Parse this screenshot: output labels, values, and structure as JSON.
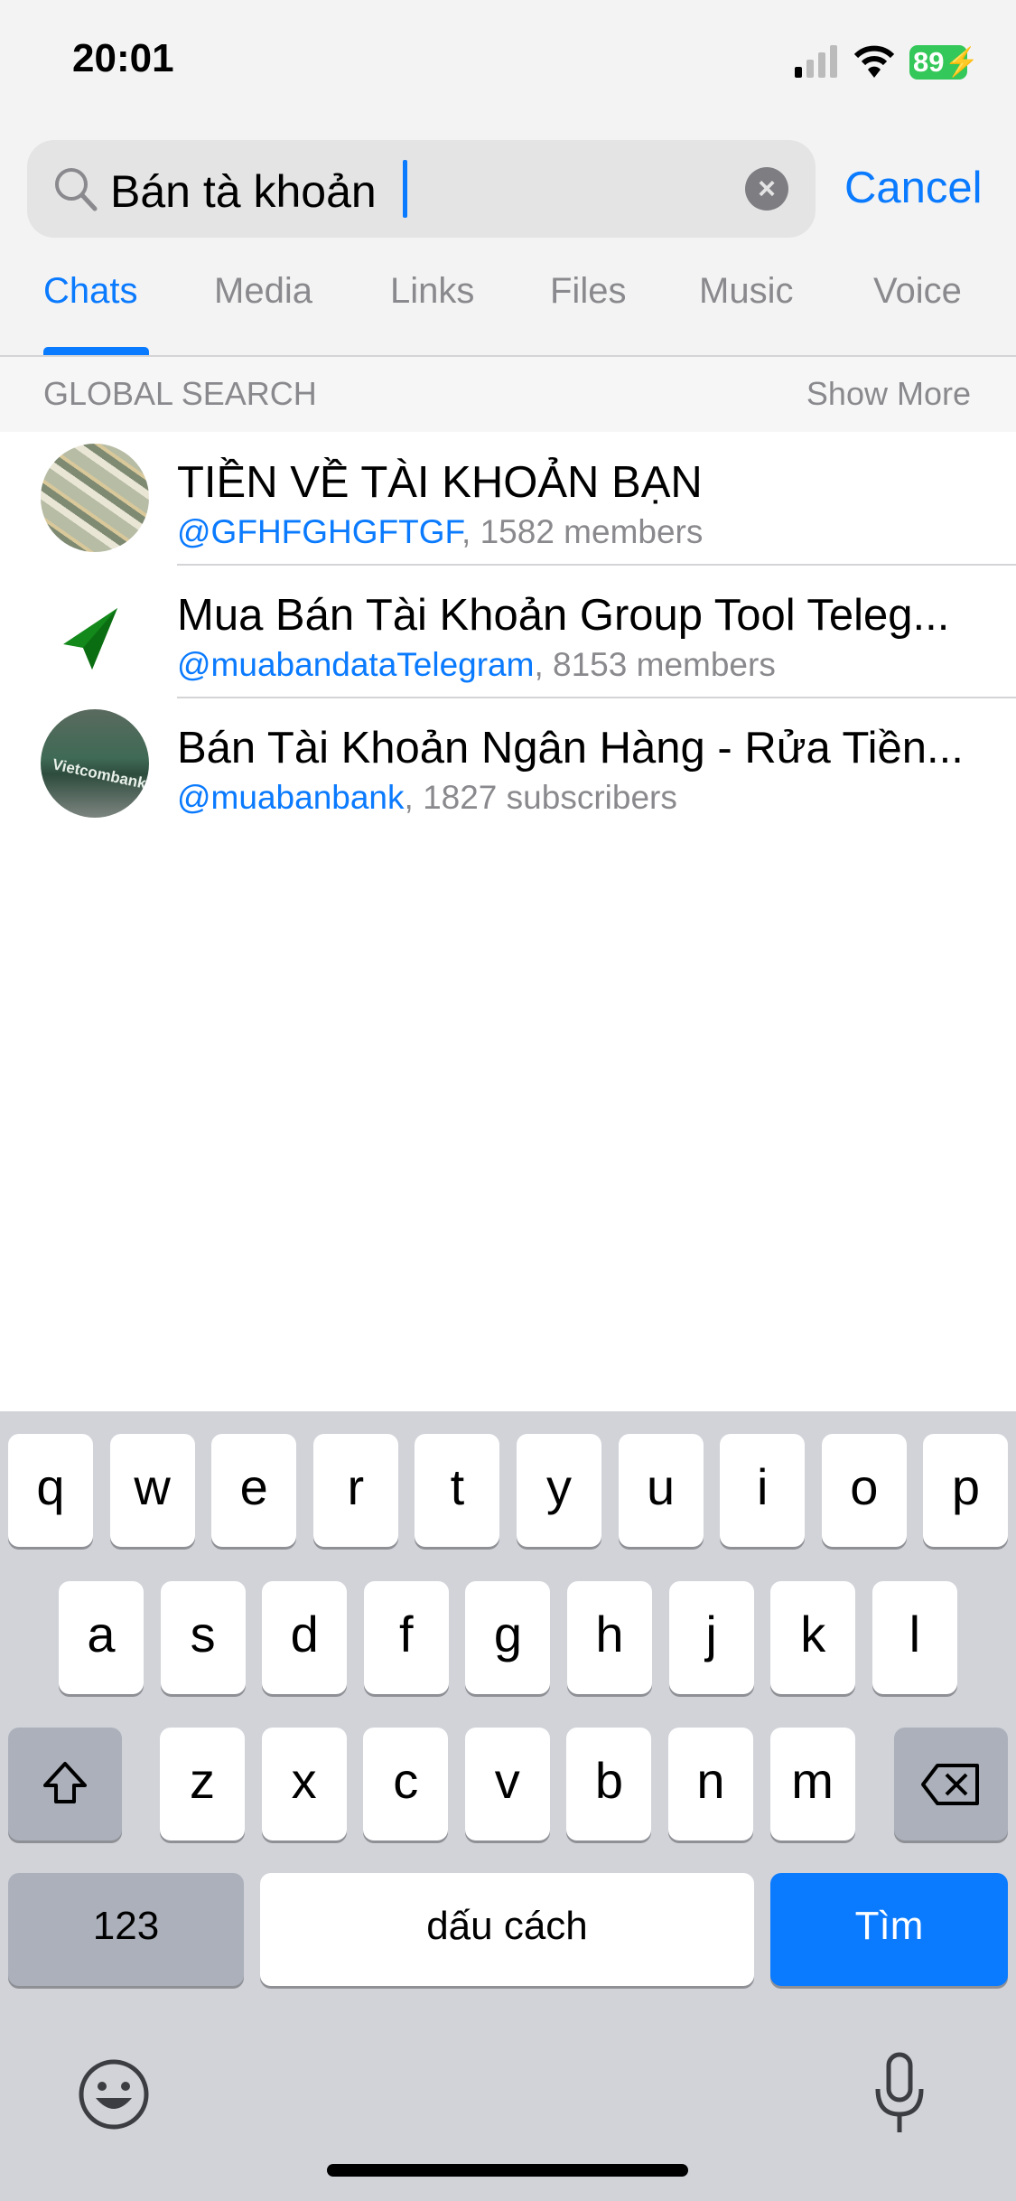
{
  "status": {
    "time": "20:01",
    "battery": "89",
    "signal-icon": "cellular-signal-icon",
    "wifi-icon": "wifi-icon"
  },
  "search": {
    "query": "Bán tà khoản",
    "cancel": "Cancel"
  },
  "tabs": [
    {
      "label": "Chats",
      "active": true
    },
    {
      "label": "Media"
    },
    {
      "label": "Links"
    },
    {
      "label": "Files"
    },
    {
      "label": "Music"
    },
    {
      "label": "Voice"
    }
  ],
  "section": {
    "title": "GLOBAL SEARCH",
    "show_more": "Show More"
  },
  "results": [
    {
      "title": "TIỀN VỀ TÀI KHOẢN BẠN",
      "username": "@GFHFGHGFTGF",
      "count": ", 1582 members"
    },
    {
      "title": "Mua Bán Tài Khoản Group Tool Teleg...",
      "username": "@muabandataTelegram",
      "count": ", 8153 members"
    },
    {
      "title": "Bán Tài Khoản Ngân Hàng - Rửa Tiền...",
      "username": "@muabanbank",
      "count": ", 1827 subscribers",
      "avatar_text": "Vietcombank"
    }
  ],
  "keyboard": {
    "row1": [
      "q",
      "w",
      "e",
      "r",
      "t",
      "y",
      "u",
      "i",
      "o",
      "p"
    ],
    "row2": [
      "a",
      "s",
      "d",
      "f",
      "g",
      "h",
      "j",
      "k",
      "l"
    ],
    "row3": [
      "z",
      "x",
      "c",
      "v",
      "b",
      "n",
      "m"
    ],
    "numbers": "123",
    "space": "dấu cách",
    "return": "Tìm"
  },
  "colors": {
    "accent": "#0a7aff",
    "battery": "#34c759",
    "telegram_green": "#12891a"
  }
}
